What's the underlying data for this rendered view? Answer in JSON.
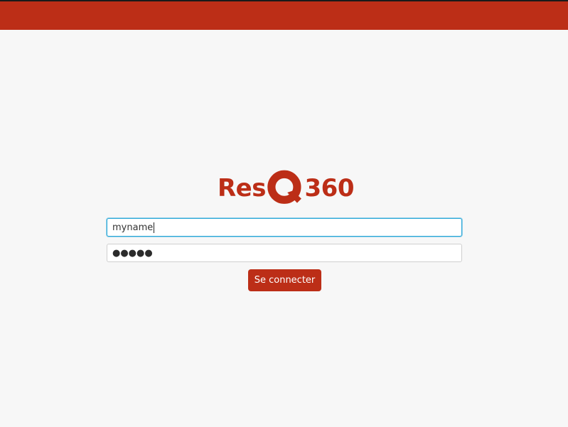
{
  "brand": {
    "logo_part1": "Res",
    "logo_letter": "Q",
    "logo_part2": "360",
    "color": "#bc2e17"
  },
  "form": {
    "username_value": "myname",
    "password_mask": "●●●●●",
    "submit_label": "Se connecter"
  },
  "theme": {
    "background": "#f7f7f7",
    "focus_color": "#2aa7d8"
  }
}
